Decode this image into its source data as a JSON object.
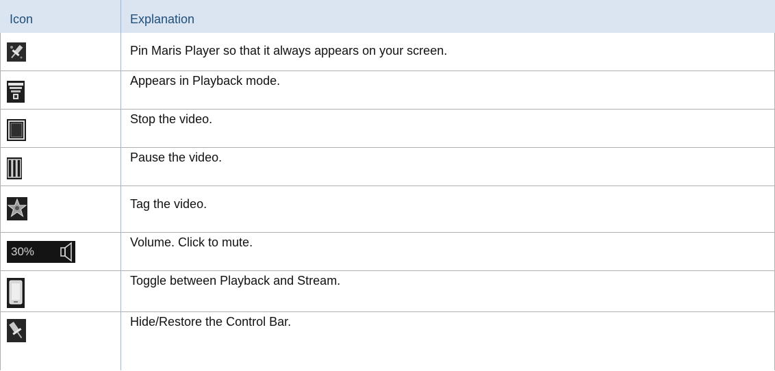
{
  "header": {
    "col_icon": "Icon",
    "col_explanation": "Explanation"
  },
  "rows": [
    {
      "icon": "pin-icon",
      "text": "Pin Maris Player so that it always appears on your screen."
    },
    {
      "icon": "playback-mode-icon",
      "text": "Appears in Playback mode."
    },
    {
      "icon": "stop-icon",
      "text": "Stop the video."
    },
    {
      "icon": "pause-icon",
      "text": "Pause the video."
    },
    {
      "icon": "star-tag-icon",
      "text": "Tag the video."
    },
    {
      "icon": "volume-icon",
      "icon_text": "30%",
      "text": "Volume. Click to mute."
    },
    {
      "icon": "toggle-stream-icon",
      "text": "Toggle between Playback and Stream."
    },
    {
      "icon": "hide-restore-pin-icon",
      "text": "Hide/Restore the Control Bar."
    }
  ]
}
